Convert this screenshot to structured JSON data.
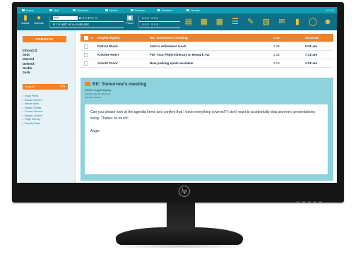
{
  "topnav": {
    "items": [
      "Home",
      "Mail",
      "Schedule",
      "Sports",
      "Finance",
      "Weather",
      "Games"
    ],
    "brand": "HP235"
  },
  "toolbar": {
    "left_buttons": [
      "Mailbar",
      "Calendar"
    ],
    "font_box": "Arial",
    "format_row1": "11 ▾  A ▾  A+ A-",
    "format_row2": "B  I  U  ABC  A²  A₂  A  ab|  abc",
    "insert_label": "Picture",
    "tool_icons": [
      "clipboard-icon",
      "table-icon",
      "calendar-icon",
      "list-icon",
      "pen-icon",
      "trash-icon",
      "inbox-icon",
      "chart-icon",
      "alarm-icon",
      "smiley-icon"
    ]
  },
  "sidebar": {
    "compose_label": "COMPOSE",
    "folders": [
      "Inbox(12)",
      "Sent",
      "Starred",
      "Deleted",
      "Drafts",
      "Junk"
    ],
    "search_label": "Search",
    "contacts": [
      "Hugo Perez",
      "Rowan Gomez",
      "Abbott West",
      "Marian Smalls",
      "Connor Vincent",
      "Marge Lunchini",
      "Paige Murray",
      "Emmily Davis"
    ]
  },
  "messages": [
    {
      "from": "Angela Bigsby",
      "subject": "RE: Tomorrow's meeting",
      "date": "3.25",
      "time": "10:12 am",
      "selected": true
    },
    {
      "from": "Patrick Black",
      "subject": "John's retirement lunch",
      "date": "3.25",
      "time": "9:55 am",
      "selected": false
    },
    {
      "from": "Kristine Hoert",
      "subject": "FW: Your Flight Itinerary to Newark, NJ",
      "date": "3.25",
      "time": "7:18 am",
      "selected": false
    },
    {
      "from": "Arnold Tonor",
      "subject": "New parking spots available",
      "date": "3.24",
      "time": "4:05 am",
      "selected": false
    }
  ],
  "reading_pane": {
    "title": "RE: Tomorrow's meeting",
    "from_line": "FROM: Angela Bigsby",
    "meta_date": "Tuesday, Mar 25, 10:12 am",
    "meta_to": "TO: Kate Russell",
    "body": "Can you please look at the agenda items and confirm that I have everything covered? I don't want to accidentally skip anyone's presentations today. Thanks so much!",
    "signature": "Angie"
  },
  "monitor": {
    "logo": "hp"
  }
}
